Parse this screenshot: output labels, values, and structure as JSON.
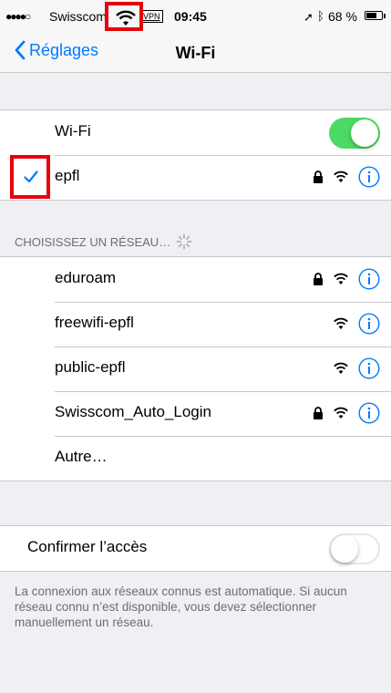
{
  "status_bar": {
    "signal": "●●●●○",
    "carrier": "Swisscom",
    "vpn": "VPN",
    "time": "09:45",
    "location_icon": "location-arrow-icon",
    "bluetooth_icon": "bluetooth-icon",
    "battery_percent": "68 %",
    "battery_level": 0.68
  },
  "nav": {
    "back_label": "Réglages",
    "title": "Wi-Fi"
  },
  "wifi_toggle": {
    "label": "Wi-Fi",
    "state": "on"
  },
  "connected_network": {
    "name": "epfl",
    "secured": true
  },
  "choose_network_header": "CHOISISSEZ UN RÉSEAU…",
  "networks": [
    {
      "name": "eduroam",
      "secured": true
    },
    {
      "name": "freewifi-epfl",
      "secured": false
    },
    {
      "name": "public-epfl",
      "secured": false
    },
    {
      "name": "Swisscom_Auto_Login",
      "secured": true
    }
  ],
  "other_label": "Autre…",
  "ask_to_join": {
    "label": "Confirmer l’accès",
    "state": "off"
  },
  "footer": "La connexion aux réseaux connus est automatique. Si aucun réseau connu n’est disponible, vous devez sélectionner manuellement un réseau.",
  "colors": {
    "accent": "#007aff",
    "toggle_on": "#4cd964",
    "highlight": "#e8000b"
  }
}
